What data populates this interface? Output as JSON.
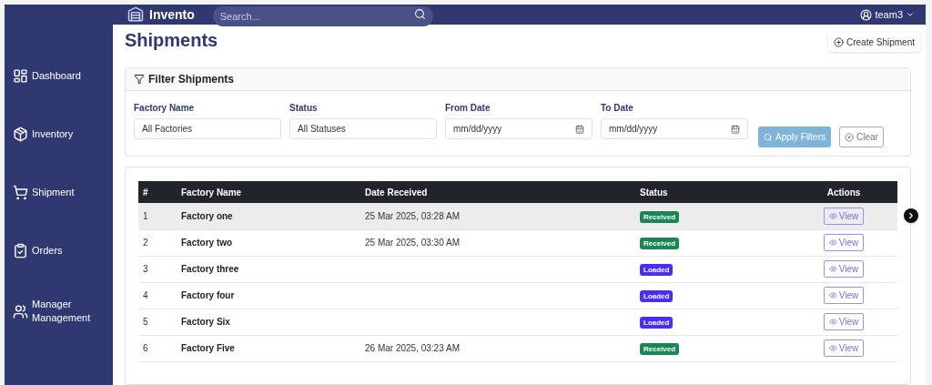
{
  "topbar": {
    "brand": "Invento",
    "search": {
      "placeholder": "Search..."
    },
    "user": "team3"
  },
  "sidebar": {
    "items": [
      {
        "label": "Dashboard",
        "kind": "dashboard"
      },
      {
        "label": "Inventory",
        "kind": "inventory"
      },
      {
        "label": "Shipment",
        "kind": "shipment"
      },
      {
        "label": "Orders",
        "kind": "orders"
      },
      {
        "label": "Manager Management",
        "kind": "managers"
      }
    ]
  },
  "page": {
    "title": "Shipments",
    "create_button": "Create Shipment"
  },
  "filter": {
    "title": "Filter Shipments",
    "fields": [
      {
        "label": "Factory Name",
        "value": "All Factories",
        "kind": "select"
      },
      {
        "label": "Status",
        "value": "All Statuses",
        "kind": "select"
      },
      {
        "label": "From Date",
        "value": "mm/dd/yyyy",
        "kind": "date"
      },
      {
        "label": "To Date",
        "value": "mm/dd/yyyy",
        "kind": "date"
      }
    ],
    "apply_button": "Apply Filters",
    "clear_button": "Clear"
  },
  "table": {
    "columns": [
      "#",
      "Factory Name",
      "Date Received",
      "Status",
      "Actions"
    ],
    "rows": [
      {
        "index": "1",
        "factory": "Factory one",
        "date": "25 Mar 2025, 03:28 AM",
        "status": "Received",
        "color": "#198754",
        "action": "View",
        "selected": true
      },
      {
        "index": "2",
        "factory": "Factory two",
        "date": "25 Mar 2025, 03:30 AM",
        "status": "Received",
        "color": "#198754",
        "action": "View",
        "selected": false
      },
      {
        "index": "3",
        "factory": "Factory three",
        "status": "Loaded",
        "color": "#4b2bff",
        "action": "View",
        "selected": false
      },
      {
        "index": "4",
        "factory": "Factory four",
        "status": "Loaded",
        "color": "#4b2bff",
        "action": "View",
        "selected": false
      },
      {
        "index": "5",
        "factory": "Factory Six",
        "status": "Loaded",
        "color": "#4b2bff",
        "action": "View",
        "selected": false
      },
      {
        "index": "6",
        "factory": "Factory Five",
        "date": "26 Mar 2025, 03:23 AM",
        "status": "Received",
        "color": "#198754",
        "action": "View",
        "selected": false
      }
    ]
  }
}
